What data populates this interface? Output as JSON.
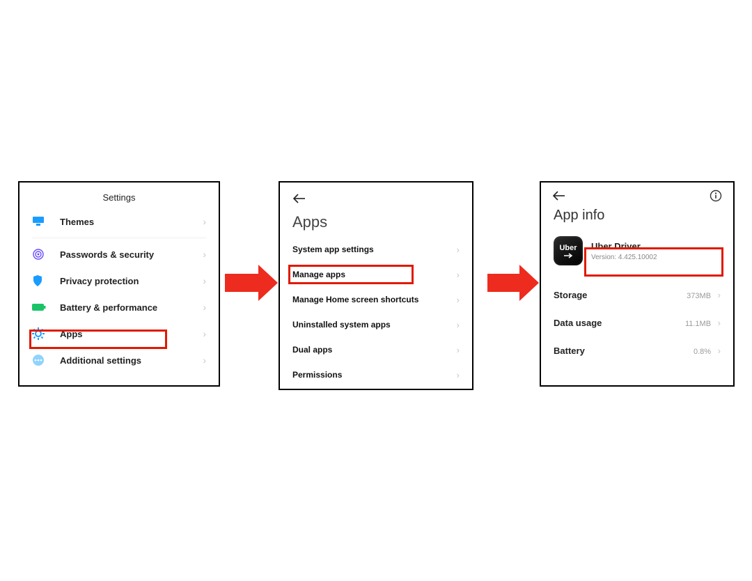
{
  "settings_panel": {
    "title": "Settings",
    "items": [
      {
        "label": "Themes"
      },
      {
        "label": "Passwords & security"
      },
      {
        "label": "Privacy protection"
      },
      {
        "label": "Battery & performance"
      },
      {
        "label": "Apps"
      },
      {
        "label": "Additional settings"
      }
    ]
  },
  "apps_panel": {
    "title": "Apps",
    "items": [
      {
        "label": "System app settings"
      },
      {
        "label": "Manage apps"
      },
      {
        "label": "Manage Home screen shortcuts"
      },
      {
        "label": "Uninstalled system apps"
      },
      {
        "label": "Dual apps"
      },
      {
        "label": "Permissions"
      }
    ]
  },
  "appinfo_panel": {
    "title": "App info",
    "app_icon_text": "Uber",
    "app_name": "Uber Driver",
    "app_version": "Version: 4.425.10002",
    "rows": [
      {
        "label": "Storage",
        "value": "373MB"
      },
      {
        "label": "Data usage",
        "value": "11.1MB"
      },
      {
        "label": "Battery",
        "value": "0.8%"
      }
    ]
  }
}
